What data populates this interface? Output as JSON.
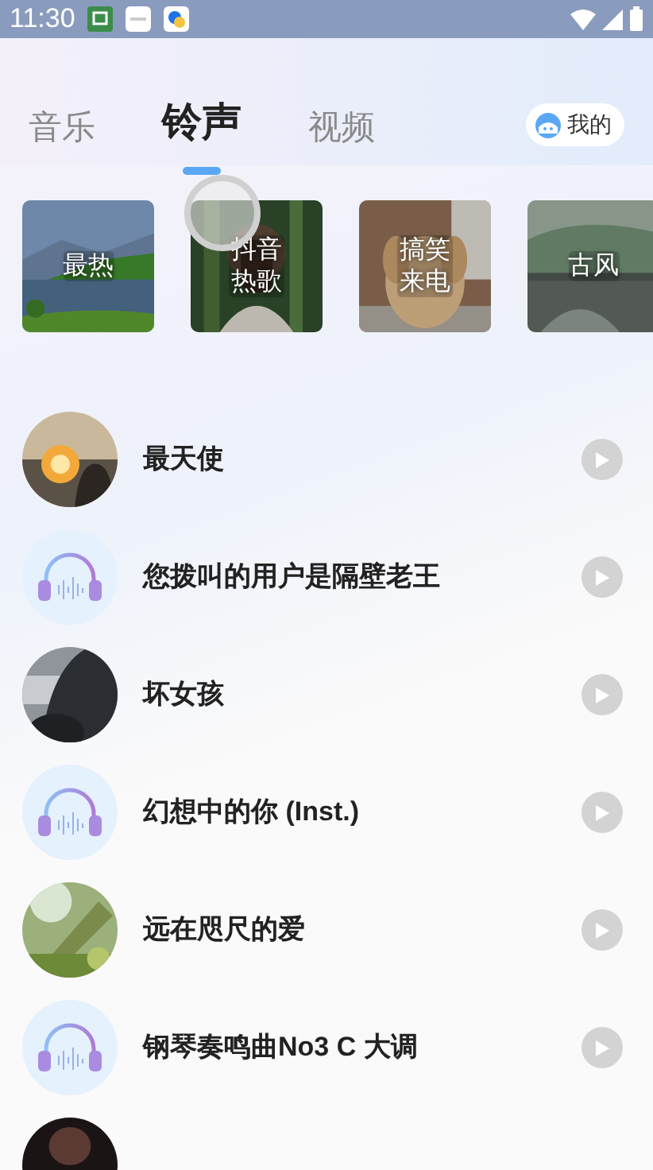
{
  "status_bar": {
    "time": "11:30"
  },
  "tabs": [
    {
      "label": "音乐",
      "selected": false
    },
    {
      "label": "铃声",
      "selected": true
    },
    {
      "label": "视频",
      "selected": false
    }
  ],
  "profile_button": {
    "label": "我的"
  },
  "loading": true,
  "categories": [
    {
      "label": "最热",
      "kind": "picture"
    },
    {
      "label": "抖音热歌",
      "kind": "picture"
    },
    {
      "label": "搞笑来电",
      "kind": "picture"
    },
    {
      "label": "古风",
      "kind": "picture"
    }
  ],
  "songs": [
    {
      "title": "最天使",
      "kind": "picture"
    },
    {
      "title": "您拨叫的用户是隔壁老王",
      "kind": "headphones"
    },
    {
      "title": "坏女孩",
      "kind": "picture"
    },
    {
      "title": "幻想中的你 (Inst.)",
      "kind": "headphones"
    },
    {
      "title": "远在咫尺的爱",
      "kind": "picture"
    },
    {
      "title": "钢琴奏鸣曲No3 C 大调",
      "kind": "headphones"
    },
    {
      "kind": "picture"
    }
  ]
}
